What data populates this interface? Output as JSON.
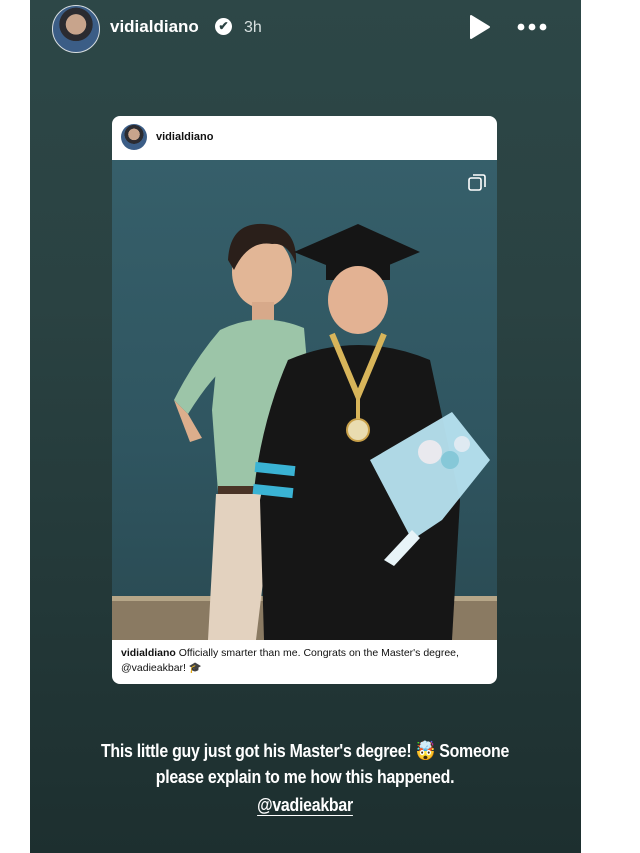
{
  "story": {
    "username": "vidialdiano",
    "verified_mark": "✔",
    "time_ago": "3h",
    "icons": {
      "avatar": "profile-photo",
      "verified": "verified-badge-icon",
      "play": "play-icon",
      "more": "more-dots-icon"
    }
  },
  "post": {
    "username": "vidialdiano",
    "caption_user": "vidialdiano",
    "caption_text": " Officially smarter than me. Congrats on the Master's degree, @vadieakbar! 🎓",
    "icons": {
      "multi": "carousel-icon"
    }
  },
  "overlay": {
    "line1": "This little guy just got his Master's degree! 🤯 Someone",
    "line2": "please explain to me how this happened.",
    "mention": "@vadieakbar"
  },
  "colors": {
    "background": "#2a4242",
    "text": "#ffffff"
  }
}
